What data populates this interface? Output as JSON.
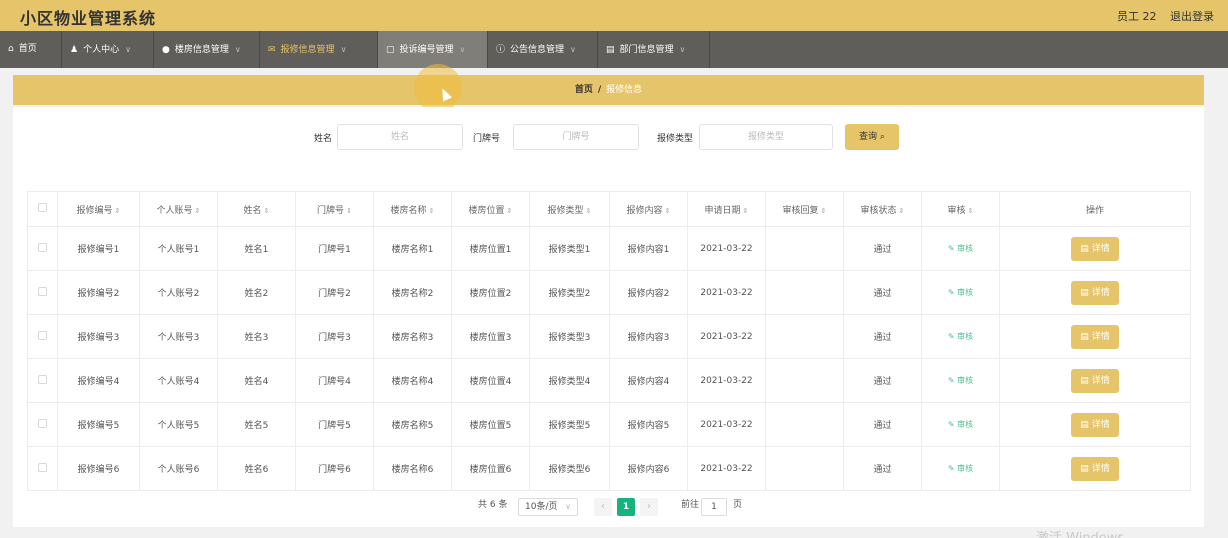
{
  "header": {
    "title": "小区物业管理系统",
    "user": "员工 22",
    "logout": "退出登录"
  },
  "nav": [
    {
      "label": "首页",
      "icon": "home-icon",
      "glyph": "⌂"
    },
    {
      "label": "个人中心",
      "icon": "user-icon",
      "glyph": "♟"
    },
    {
      "label": "楼房信息管理",
      "icon": "location-icon",
      "glyph": "●"
    },
    {
      "label": "报修信息管理",
      "icon": "mail-icon",
      "glyph": "✉"
    },
    {
      "label": "投诉编号管理",
      "icon": "message-icon",
      "glyph": "▢"
    },
    {
      "label": "公告信息管理",
      "icon": "info-icon",
      "glyph": "ⓘ"
    },
    {
      "label": "部门信息管理",
      "icon": "document-icon",
      "glyph": "▤"
    }
  ],
  "breadcrumb": {
    "home": "首页",
    "sep": "/",
    "current": "报修信息"
  },
  "search": {
    "name_label": "姓名",
    "name_placeholder": "姓名",
    "door_label": "门牌号",
    "door_placeholder": "门牌号",
    "type_label": "报修类型",
    "type_placeholder": "报修类型",
    "button": "查询 ⌕"
  },
  "table": {
    "sort_glyph": "⇕",
    "headers": [
      "报修编号",
      "个人账号",
      "姓名",
      "门牌号",
      "楼房名称",
      "楼房位置",
      "报修类型",
      "报修内容",
      "申请日期",
      "审核回复",
      "审核状态",
      "审核",
      "操作"
    ],
    "audit_label": "审核",
    "audit_glyph": "✎",
    "detail_label": "详情",
    "detail_glyph": "▤",
    "rows": [
      [
        "报修编号1",
        "个人账号1",
        "姓名1",
        "门牌号1",
        "楼房名称1",
        "楼房位置1",
        "报修类型1",
        "报修内容1",
        "2021-03-22",
        "",
        "通过"
      ],
      [
        "报修编号2",
        "个人账号2",
        "姓名2",
        "门牌号2",
        "楼房名称2",
        "楼房位置2",
        "报修类型2",
        "报修内容2",
        "2021-03-22",
        "",
        "通过"
      ],
      [
        "报修编号3",
        "个人账号3",
        "姓名3",
        "门牌号3",
        "楼房名称3",
        "楼房位置3",
        "报修类型3",
        "报修内容3",
        "2021-03-22",
        "",
        "通过"
      ],
      [
        "报修编号4",
        "个人账号4",
        "姓名4",
        "门牌号4",
        "楼房名称4",
        "楼房位置4",
        "报修类型4",
        "报修内容4",
        "2021-03-22",
        "",
        "通过"
      ],
      [
        "报修编号5",
        "个人账号5",
        "姓名5",
        "门牌号5",
        "楼房名称5",
        "楼房位置5",
        "报修类型5",
        "报修内容5",
        "2021-03-22",
        "",
        "通过"
      ],
      [
        "报修编号6",
        "个人账号6",
        "姓名6",
        "门牌号6",
        "楼房名称6",
        "楼房位置6",
        "报修类型6",
        "报修内容6",
        "2021-03-22",
        "",
        "通过"
      ]
    ]
  },
  "pagination": {
    "total": "共 6 条",
    "page_size": "10条/页",
    "current_page": "1",
    "goto_label": "前往",
    "goto_value": "1",
    "page_suffix": "页"
  },
  "watermark": "激活 Windows",
  "colors": {
    "accent": "#e6c469",
    "nav_bg": "#5f5e5a",
    "pager_active": "#16b37e",
    "link": "#4cbc8e"
  }
}
